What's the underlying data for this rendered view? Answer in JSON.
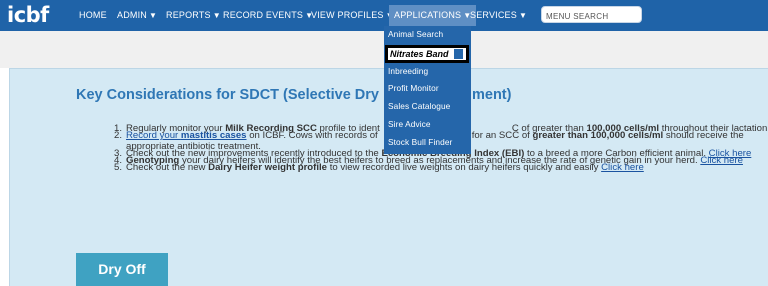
{
  "nav": {
    "logo": "icbf",
    "items": [
      {
        "label": "HOME",
        "chevron": false
      },
      {
        "label": "ADMIN",
        "chevron": true
      },
      {
        "label": "REPORTS",
        "chevron": true
      },
      {
        "label": "RECORD EVENTS",
        "chevron": true
      },
      {
        "label": "VIEW PROFILES",
        "chevron": true
      },
      {
        "label": "APPLICATIONS",
        "chevron": true,
        "active": true
      },
      {
        "label": "SERVICES",
        "chevron": true
      }
    ],
    "search_placeholder": "MENU SEARCH"
  },
  "dropdown": {
    "items": [
      "Animal Search",
      "Nitrates Band",
      "Inbreeding",
      "Profit Monitor",
      "Sales Catalogue",
      "Sire Advice",
      "Stock Bull Finder"
    ],
    "highlighted_index": 1
  },
  "panel": {
    "title": "Key Considerations for SDCT (Selective Dry",
    "title_end": "ment)",
    "items": {
      "i1": {
        "num": "1.",
        "a": "Regularly monitor your ",
        "b": "Milk Recording SCC",
        "c": " profile to ident",
        "d": "C of greater than ",
        "e": "100,000 cells/ml",
        "f": " throughout their lactation."
      },
      "i2": {
        "num": "2.",
        "link_a": "Record your ",
        "link_b": "mastitis cases",
        "a": " on ICBF. Cows with records of",
        "b": "for an SCC of ",
        "c": "greater than 100,000 cells/ml",
        "d": " should receive the",
        "line2": "appropriate antibiotic treatment."
      },
      "i3": {
        "num": "3.",
        "a": "Check out the new improvements recently introduced to the ",
        "b": "Economic Breeding Index (EBI)",
        "c": " to a breed a more Carbon efficient animal. ",
        "link": "Click here"
      },
      "i4": {
        "num": "4.",
        "b": "Genotyping",
        "a": " your dairy heifers will identify the best heifers to breed as replacements and increase the rate of genetic gain in your herd. ",
        "link": "Click here"
      },
      "i5": {
        "num": "5.",
        "a": "Check out the new ",
        "b": "Dairy Heifer weight profile",
        "c": " to view recorded live weights on dairy heifers quickly and easily ",
        "link": "Click here"
      }
    },
    "button": "Dry Off"
  },
  "colors": {
    "navbar": "#1f63a8",
    "dropdown": "#2566aa",
    "panel": "#d4e9f4",
    "title": "#2f77b5",
    "button": "#3fa2c2"
  }
}
